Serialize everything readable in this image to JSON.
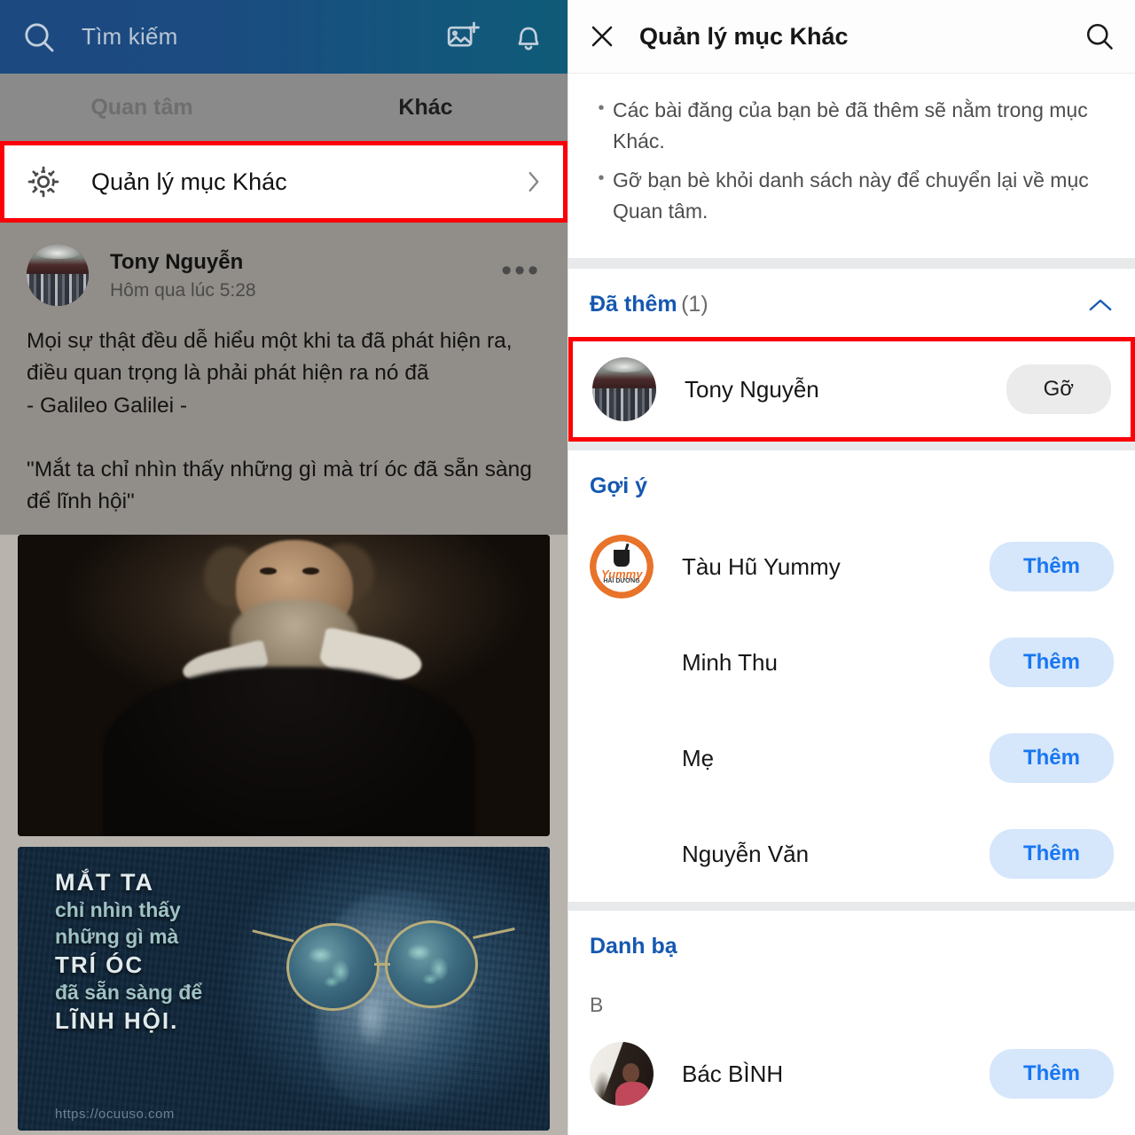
{
  "left": {
    "topbar": {
      "search_placeholder": "Tìm kiếm",
      "search_icon": "search-icon",
      "photo_icon": "add-photo-icon",
      "bell_icon": "bell-icon"
    },
    "tabs": [
      {
        "label": "Quan tâm",
        "active": false
      },
      {
        "label": "Khác",
        "active": true
      }
    ],
    "manage_row": {
      "icon": "gear-icon",
      "label": "Quản lý mục Khác",
      "chevron": "chevron-right-icon"
    },
    "post": {
      "author": "Tony Nguyễn",
      "timestamp": "Hôm qua lúc 5:28",
      "more_label": "•••",
      "body": "Mọi sự thật đều dễ hiểu một khi ta đã phát hiện ra,\nđiều quan trọng là phải phát hiện ra nó đã\n- Galileo Galilei -\n\n\"Mắt ta chỉ nhìn thấy những gì mà trí óc đã sẵn sàng\nđể lĩnh hội\""
    },
    "media": {
      "photo1_alt": "portrait-of-galileo-galilei",
      "photo2_alt": "quote-image-eyeglasses",
      "quote_lines": [
        "MẮT TA",
        "chỉ nhìn thấy",
        "những gì mà",
        "TRÍ ÓC",
        "đã sẵn sàng để",
        "LĨNH HỘI."
      ],
      "watermark": "https://ocuuso.com"
    }
  },
  "right": {
    "header": {
      "close_icon": "close-icon",
      "title": "Quản lý mục Khác",
      "search_icon": "search-icon"
    },
    "notes": [
      "Các bài đăng của bạn bè đã thêm sẽ nằm trong mục Khác.",
      "Gỡ bạn bè khỏi danh sách này để chuyển lại về mục Quan tâm."
    ],
    "added_section": {
      "title": "Đã thêm",
      "count": "(1)",
      "collapse_icon": "chevron-up-icon",
      "items": [
        {
          "name": "Tony Nguyễn",
          "action": "Gỡ",
          "avatar": "group-photo",
          "highlighted": true
        }
      ]
    },
    "suggestions_section": {
      "title": "Gợi ý",
      "items": [
        {
          "name": "Tàu Hũ Yummy",
          "action": "Thêm",
          "avatar": "yummy-logo"
        },
        {
          "name": "Minh Thu",
          "action": "Thêm",
          "avatar": "blank"
        },
        {
          "name": "Mẹ",
          "action": "Thêm",
          "avatar": "blank"
        },
        {
          "name": "Nguyễn Văn",
          "action": "Thêm",
          "avatar": "blank"
        }
      ]
    },
    "contacts_section": {
      "title": "Danh bạ",
      "letter": "B",
      "items": [
        {
          "name": "Bác BÌNH",
          "action": "Thêm",
          "avatar": "person-photo"
        }
      ]
    }
  },
  "colors": {
    "highlight_red": "#fb0007",
    "link_blue": "#1558b0",
    "action_blue": "#1877f2",
    "action_blue_bg": "#d6e6fb",
    "topbar_blue": "#1c4a80",
    "topbar_teal": "#0f5b78"
  }
}
